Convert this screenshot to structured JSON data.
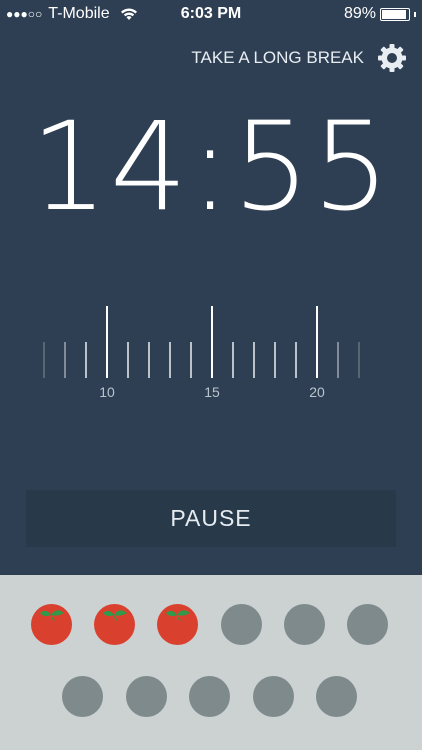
{
  "status": {
    "signal": "●●●○○",
    "carrier": "T-Mobile",
    "time": "6:03 PM",
    "battery": "89%"
  },
  "header": {
    "action_label": "TAKE A LONG BREAK"
  },
  "timer": {
    "display": "14:55"
  },
  "ruler": {
    "labels": [
      "10",
      "15",
      "20"
    ]
  },
  "controls": {
    "pause_label": "PAUSE"
  },
  "pomodoros": {
    "total": 11,
    "completed": 3
  },
  "colors": {
    "background": "#2e3f53",
    "tomato": "#d9402e",
    "empty": "#7e8a8b",
    "tray": "#ccd1d1"
  }
}
